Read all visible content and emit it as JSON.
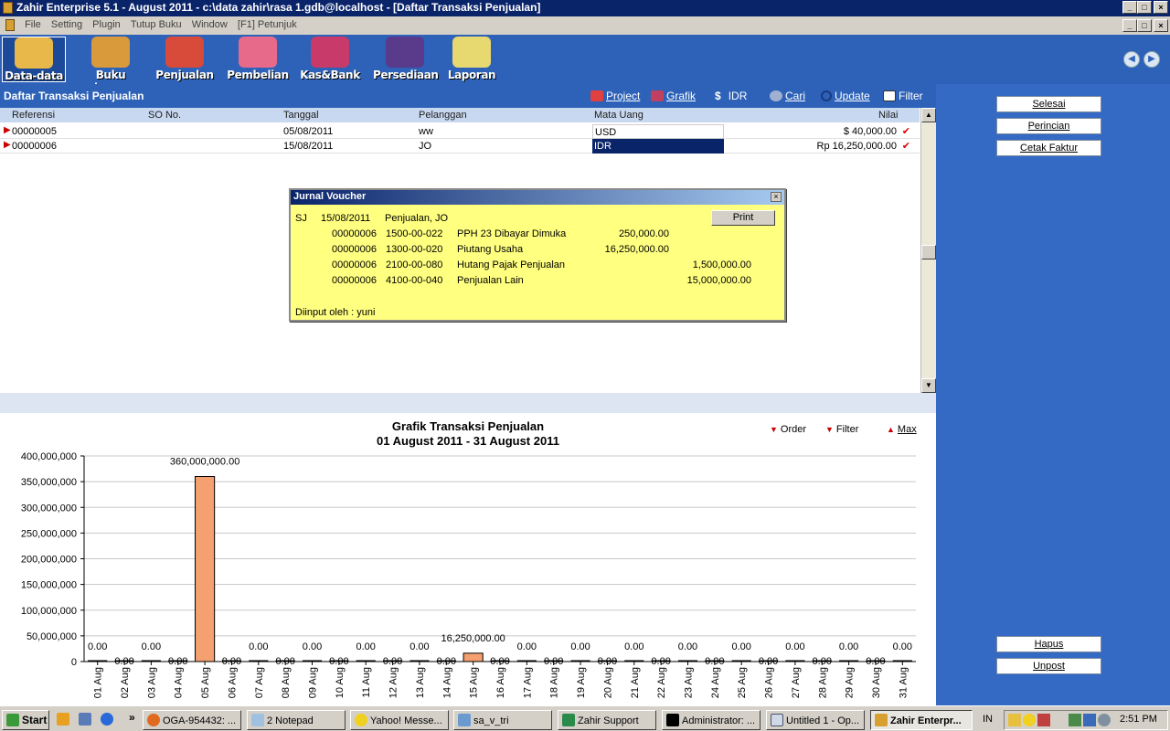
{
  "window": {
    "title": "Zahir Enterprise 5.1 - August 2011 - c:\\data zahir\\rasa 1.gdb@localhost - [Daftar Transaksi Penjualan]",
    "btn_min": "_",
    "btn_max": "□",
    "btn_close": "×"
  },
  "menu": [
    "File",
    "Setting",
    "Plugin",
    "Tutup Buku",
    "Window",
    "[F1] Petunjuk"
  ],
  "toolbar": [
    {
      "label": "Data-data",
      "color": "#e8b84a"
    },
    {
      "label": "Buku besar",
      "color": "#d89a3a"
    },
    {
      "label": "Penjualan",
      "color": "#d84a3a"
    },
    {
      "label": "Pembelian",
      "color": "#e86a8a"
    },
    {
      "label": "Kas&Bank",
      "color": "#c83a6a"
    },
    {
      "label": "Persediaan",
      "color": "#5a3a8a"
    },
    {
      "label": "Laporan",
      "color": "#e8d870"
    }
  ],
  "nav": {
    "back": "◀",
    "forward": "▶"
  },
  "list": {
    "title": "Daftar Transaksi Penjualan",
    "actions": [
      "Project",
      "Grafik",
      "IDR",
      "Cari",
      "Update",
      "Filter"
    ],
    "columns": [
      "Referensi",
      "SO No.",
      "Tanggal",
      "Pelanggan",
      "Mata Uang",
      "Nilai"
    ],
    "row_marker": "▶",
    "check": "✔",
    "rows": [
      {
        "ref": "00000005",
        "so": "",
        "date": "05/08/2011",
        "customer": "ww",
        "currency": "USD",
        "value": "$ 40,000.00"
      },
      {
        "ref": "00000006",
        "so": "",
        "date": "15/08/2011",
        "customer": "JO",
        "currency": "IDR",
        "value": "Rp 16,250,000.00"
      }
    ]
  },
  "scroll": {
    "up": "▲",
    "down": "▼"
  },
  "voucher": {
    "title": "Jurnal Voucher",
    "close": "×",
    "type": "SJ",
    "date": "15/08/2011",
    "desc": "Penjualan, JO",
    "print": "Print",
    "lines": [
      {
        "ref": "00000006",
        "acct": "1500-00-022",
        "name": "PPH 23 Dibayar Dimuka",
        "debit": "250,000.00",
        "credit": ""
      },
      {
        "ref": "00000006",
        "acct": "1300-00-020",
        "name": "Piutang Usaha",
        "debit": "16,250,000.00",
        "credit": ""
      },
      {
        "ref": "00000006",
        "acct": "2100-00-080",
        "name": "Hutang Pajak Penjualan",
        "debit": "",
        "credit": "1,500,000.00"
      },
      {
        "ref": "00000006",
        "acct": "4100-00-040",
        "name": "Penjualan Lain",
        "debit": "",
        "credit": "15,000,000.00"
      }
    ],
    "footer": "Diinput oleh : yuni"
  },
  "side_buttons": [
    "Selesai",
    "Perincian",
    "Cetak Faktur",
    "Hapus",
    "Unpost"
  ],
  "chart_actions": [
    "Order",
    "Filter",
    "Max"
  ],
  "chart_data": {
    "type": "bar",
    "title": "Grafik Transaksi Penjualan",
    "subtitle": "01 August 2011 - 31 August 2011",
    "xlabel": "",
    "ylabel": "",
    "ylim": [
      0,
      400000000
    ],
    "yticks": [
      "0",
      "50,000,000",
      "100,000,000",
      "150,000,000",
      "200,000,000",
      "250,000,000",
      "300,000,000",
      "350,000,000",
      "400,000,000"
    ],
    "bar_color": "#f4a070",
    "categories": [
      "01 Aug",
      "02 Aug",
      "03 Aug",
      "04 Aug",
      "05 Aug",
      "06 Aug",
      "07 Aug",
      "08 Aug",
      "09 Aug",
      "10 Aug",
      "11 Aug",
      "12 Aug",
      "13 Aug",
      "14 Aug",
      "15 Aug",
      "16 Aug",
      "17 Aug",
      "18 Aug",
      "19 Aug",
      "20 Aug",
      "21 Aug",
      "22 Aug",
      "23 Aug",
      "24 Aug",
      "25 Aug",
      "26 Aug",
      "27 Aug",
      "28 Aug",
      "29 Aug",
      "30 Aug",
      "31 Aug"
    ],
    "values": [
      0,
      0,
      0,
      0,
      360000000,
      0,
      0,
      0,
      0,
      0,
      0,
      0,
      0,
      0,
      16250000,
      0,
      0,
      0,
      0,
      0,
      0,
      0,
      0,
      0,
      0,
      0,
      0,
      0,
      0,
      0,
      0
    ],
    "labels": [
      "0.00",
      "0.00",
      "0.00",
      "0.00",
      "360,000,000.00",
      "0.00",
      "0.00",
      "0.00",
      "0.00",
      "0.00",
      "0.00",
      "0.00",
      "0.00",
      "0.00",
      "16,250,000.00",
      "0.00",
      "0.00",
      "0.00",
      "0.00",
      "0.00",
      "0.00",
      "0.00",
      "0.00",
      "0.00",
      "0.00",
      "0.00",
      "0.00",
      "0.00",
      "0.00",
      "0.00",
      "0.00"
    ],
    "zero_label": "0.00"
  },
  "taskbar": {
    "start": "Start",
    "more": "»",
    "tasks": [
      "OGA-954432: ...",
      "2 Notepad",
      "Yahoo! Messe...",
      "sa_v_tri",
      "Zahir Support",
      "Administrator: ...",
      "Untitled 1 - Op...",
      "Zahir Enterpr..."
    ],
    "lang": "IN",
    "clock": "2:51 PM"
  }
}
